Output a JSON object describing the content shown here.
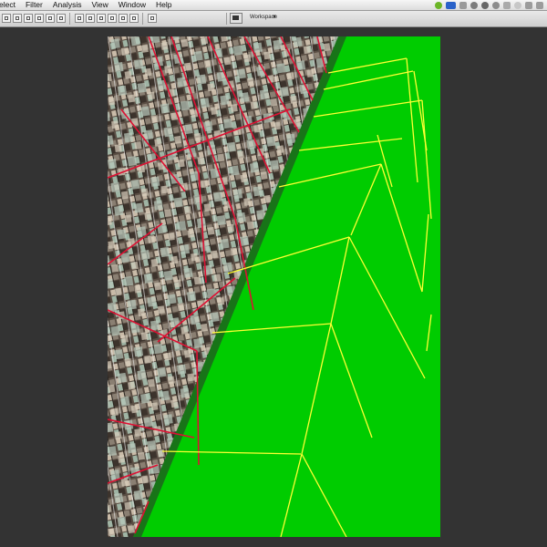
{
  "menubar": {
    "items": [
      "elect",
      "Filter",
      "Analysis",
      "View",
      "Window",
      "Help"
    ]
  },
  "options_bar": {
    "workspace_label": "Workspace",
    "workspace_arrow": "▼"
  },
  "colors": {
    "background": "#333333",
    "canvas_green": "#00cc00",
    "grid_yellow": "#ffff33",
    "grid_red": "#dd1133"
  }
}
